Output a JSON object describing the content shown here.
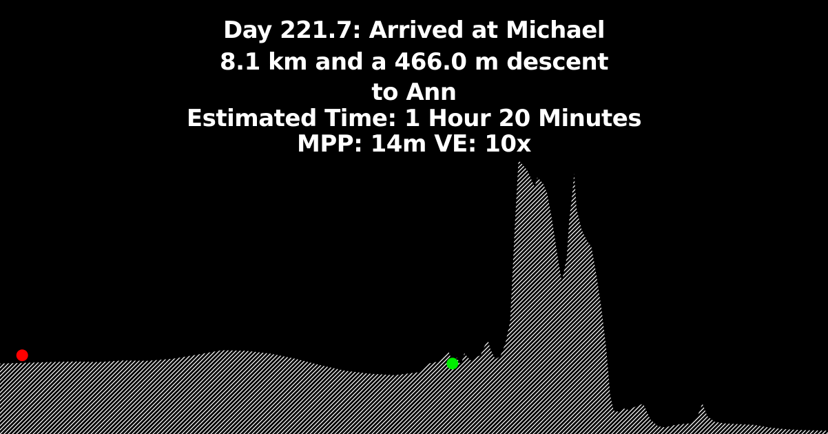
{
  "header": {
    "line1": "Day 221.7: Arrived at Michael",
    "line2": "8.1 km and a 466.0 m descent",
    "line3": "to Ann",
    "line4": "Estimated Time: 1 Hour 20 Minutes",
    "line5": "MPP: 14m VE: 10x"
  },
  "colors": {
    "background": "#000000",
    "fill_hatch": "#ffffff",
    "text": "#ffffff",
    "start_marker": "#ff0000",
    "end_marker": "#00ee00"
  },
  "chart_data": {
    "type": "area",
    "title": "",
    "xlabel": "",
    "ylabel": "",
    "x_unit": "km",
    "y_unit": "m",
    "xlim": [
      0,
      16.8
    ],
    "ylim": [
      0,
      1450
    ],
    "grid": false,
    "legend": "none",
    "series": [
      {
        "x": [
          0,
          0.5,
          1.0,
          1.5,
          2.0,
          2.5,
          3.0,
          3.5,
          4.0,
          4.5,
          5.0,
          5.5,
          6.0,
          6.5,
          7.0,
          7.5,
          8.0,
          8.5,
          8.7,
          8.9,
          9.1,
          9.2,
          9.27,
          9.35,
          9.42,
          9.55,
          9.65,
          9.75,
          9.82,
          9.9,
          9.95,
          10.0,
          10.05,
          10.15,
          10.25,
          10.35,
          10.4,
          10.45,
          10.52,
          10.6,
          10.7,
          10.8,
          10.85,
          10.9,
          10.95,
          11.02,
          11.1,
          11.2,
          11.3,
          11.4,
          11.5,
          11.55,
          11.6,
          11.65,
          11.7,
          11.8,
          11.9,
          12.0,
          12.1,
          12.2,
          12.3,
          12.38,
          12.45,
          12.5,
          12.58,
          12.65,
          12.75,
          12.9,
          13.05,
          13.2,
          13.35,
          13.5,
          13.65,
          13.8,
          14.0,
          14.15,
          14.25,
          14.35,
          14.5,
          14.7,
          15.0,
          15.3,
          15.6,
          15.9,
          16.2,
          16.5,
          16.8
        ],
        "y": [
          345,
          348,
          352,
          355,
          352,
          360,
          358,
          368,
          388,
          410,
          407,
          393,
          368,
          337,
          310,
          295,
          288,
          302,
          345,
          355,
          405,
          338,
          375,
          335,
          395,
          360,
          375,
          385,
          425,
          460,
          415,
          390,
          365,
          380,
          440,
          550,
          790,
          1040,
          1340,
          1320,
          1290,
          1235,
          1210,
          1255,
          1245,
          1225,
          1180,
          1050,
          890,
          745,
          865,
          1050,
          1150,
          1275,
          1100,
          1000,
          950,
          915,
          780,
          620,
          420,
          190,
          115,
          110,
          110,
          125,
          118,
          135,
          148,
          70,
          38,
          32,
          42,
          48,
          52,
          85,
          150,
          88,
          60,
          52,
          48,
          45,
          32,
          24,
          20,
          18,
          16
        ]
      }
    ],
    "markers": [
      {
        "name": "start",
        "x": 0.45,
        "y": 385,
        "color": "#ff0000"
      },
      {
        "name": "end",
        "x": 9.18,
        "y": 345,
        "color": "#00ee00"
      }
    ]
  }
}
